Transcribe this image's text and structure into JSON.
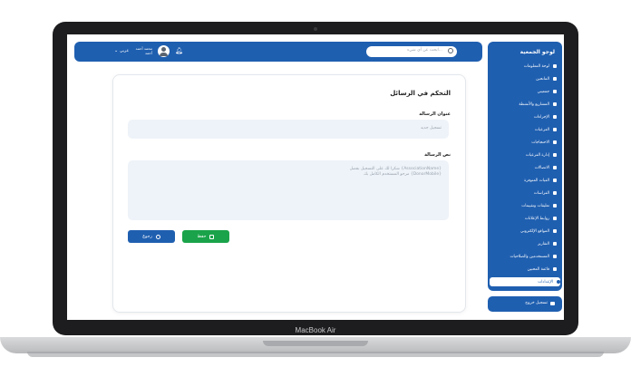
{
  "device": {
    "label": "MacBook Air"
  },
  "topbar": {
    "search_placeholder": "ابحث عن أي شيء...",
    "language": "عربي",
    "user_name_line1": "محمد أحمد",
    "user_name_line2": "أحمد"
  },
  "sidebar": {
    "title": "لوجو الجمعية",
    "items": [
      {
        "label": "لوحة المعلومات",
        "icon": "grid-icon"
      },
      {
        "label": "المانحين",
        "icon": "user-icon"
      },
      {
        "label": "جمعيتي",
        "icon": "heart-icon"
      },
      {
        "label": "المشاريع والأنشطة",
        "icon": "briefcase-icon"
      },
      {
        "label": "الإجراءات",
        "icon": "list-icon"
      },
      {
        "label": "الفرعيات",
        "icon": "file-icon"
      },
      {
        "label": "الاحتجاجات",
        "icon": "chat-icon"
      },
      {
        "label": "إدارة الفرعيات",
        "icon": "swap-icon"
      },
      {
        "label": "الاتصالات",
        "icon": "phone-icon"
      },
      {
        "label": "الفيات المتوفرة",
        "icon": "globe-icon"
      },
      {
        "label": "الفراسات",
        "icon": "circle-icon"
      },
      {
        "label": "تعليقات وتقييمات",
        "icon": "star-icon"
      },
      {
        "label": "روابط الإعلانات",
        "icon": "share-icon"
      },
      {
        "label": "المواقع الإلكتروني",
        "icon": "location-icon"
      },
      {
        "label": "التقارير",
        "icon": "report-icon"
      },
      {
        "label": "المستخدمين والصلاحيات",
        "icon": "users-icon"
      },
      {
        "label": "قائمة المحبين",
        "icon": "users-icon"
      },
      {
        "label": "الإعدادات",
        "icon": "gear-icon",
        "active": true
      }
    ],
    "logout_label": "تسجيل خروج"
  },
  "main": {
    "title": "التحكم في الرسائل",
    "subject_label": "عنوان الرسالة",
    "subject_placeholder": "تسجيل جديد",
    "body_label": "نص الرسالة",
    "body_placeholder_line1": "شكرا لك على التسجيل بفضل {AssociationName}",
    "body_placeholder_line2": "مرحو المستخدم الكامل بك {DonorMobile}",
    "save_label": "حفظ",
    "back_label": "رجوع"
  },
  "colors": {
    "primary": "#1f5fb0",
    "save": "#1aa34a",
    "field": "#eef3f9"
  }
}
